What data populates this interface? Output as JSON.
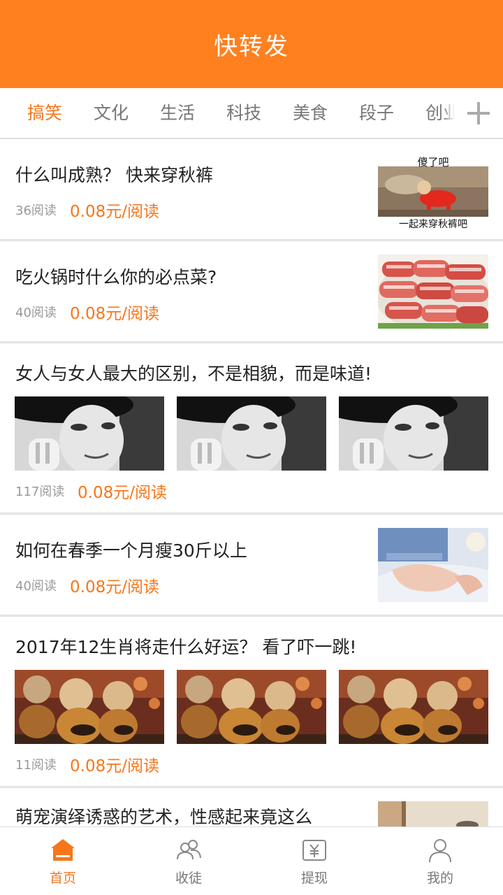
{
  "header": {
    "title": "快转发"
  },
  "tabs": [
    "搞笑",
    "文化",
    "生活",
    "科技",
    "美食",
    "段子",
    "创业"
  ],
  "tab_add_icon": "plus-icon",
  "articles": [
    {
      "title": "什么叫成熟？ 快来穿秋裤",
      "reads": "36阅读",
      "price": "0.08元/阅读",
      "image_caption_top": "傻了吧",
      "image_caption_bottom": "一起来穿秋裤吧"
    },
    {
      "title": "吃火锅时什么你的必点菜?",
      "reads": "40阅读",
      "price": "0.08元/阅读"
    },
    {
      "title": "女人与女人最大的区别，不是相貌，而是味道!",
      "reads": "117阅读",
      "price": "0.08元/阅读"
    },
    {
      "title": "如何在春季一个月瘦30斤以上",
      "reads": "40阅读",
      "price": "0.08元/阅读"
    },
    {
      "title": "2017年12生肖将走什么好运？ 看了吓一跳!",
      "reads": "11阅读",
      "price": "0.08元/阅读"
    },
    {
      "title": "萌宠演绎诱惑的艺术，性感起来竟这么"
    }
  ],
  "nav": [
    {
      "label": "首页",
      "icon": "home-icon"
    },
    {
      "label": "收徒",
      "icon": "users-icon"
    },
    {
      "label": "提现",
      "icon": "yuan-icon"
    },
    {
      "label": "我的",
      "icon": "user-icon"
    }
  ],
  "colors": {
    "brand": "#fe801f",
    "accent": "#f7761a"
  }
}
